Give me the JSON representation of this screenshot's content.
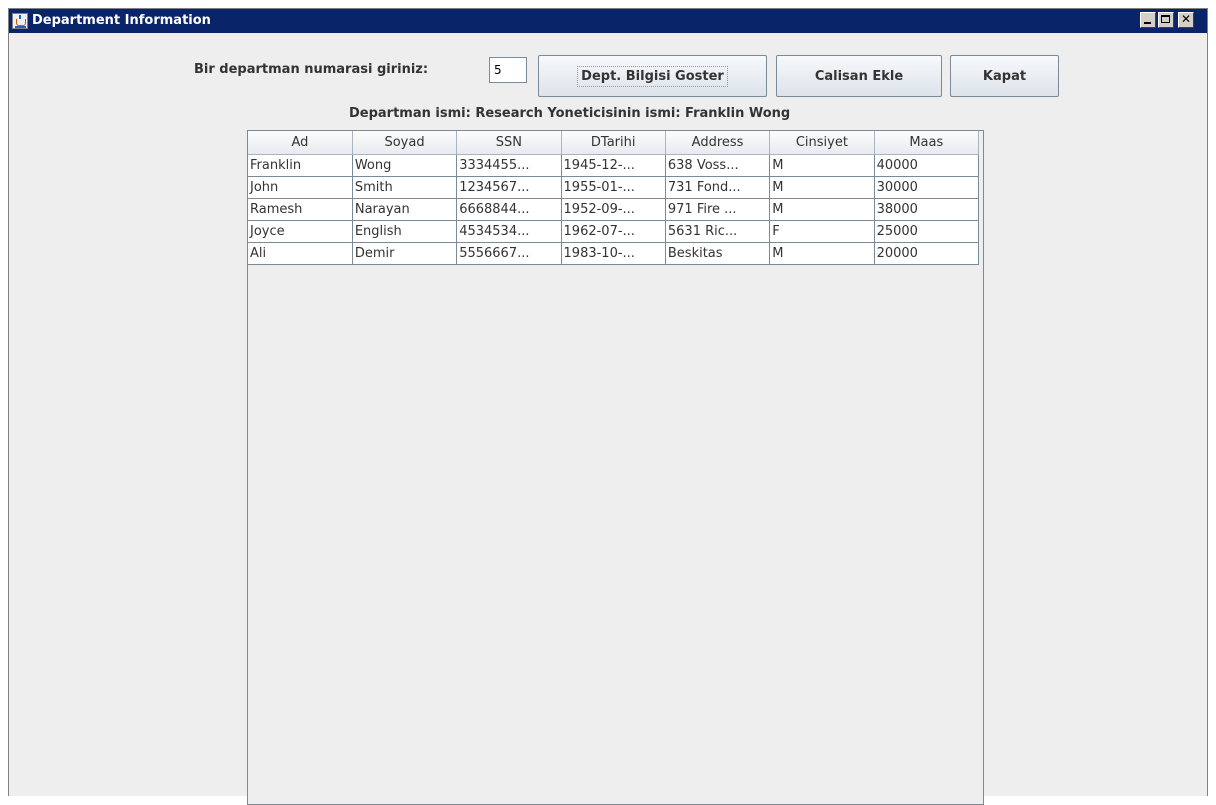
{
  "window": {
    "title": "Department Information"
  },
  "form": {
    "prompt_label": "Bir departman numarasi giriniz:",
    "dept_number_value": "5",
    "show_button_label": "Dept. Bilgisi Goster",
    "add_employee_button_label": "Calisan Ekle",
    "close_button_label": "Kapat"
  },
  "info": {
    "summary": "Departman ismi: Research Yoneticisinin ismi: Franklin Wong"
  },
  "table": {
    "headers": [
      "Ad",
      "Soyad",
      "SSN",
      "DTarihi",
      "Address",
      "Cinsiyet",
      "Maas"
    ],
    "rows": [
      [
        "Franklin",
        "Wong",
        "3334455...",
        "1945-12-...",
        "638 Voss...",
        "M",
        "40000"
      ],
      [
        "John",
        "Smith",
        "1234567...",
        "1955-01-...",
        "731 Fond...",
        "M",
        "30000"
      ],
      [
        "Ramesh",
        "Narayan",
        "6668844...",
        "1952-09-...",
        "971 Fire ...",
        "M",
        "38000"
      ],
      [
        "Joyce",
        "English",
        "4534534...",
        "1962-07-...",
        "5631 Ric...",
        "F",
        "25000"
      ],
      [
        "Ali",
        "Demir",
        "5556667...",
        "1983-10-...",
        "Beskitas",
        "M",
        "20000"
      ]
    ]
  },
  "icons": {
    "app": "java-cup-icon",
    "minimize": "minimize-icon",
    "maximize": "maximize-icon",
    "close": "close-icon"
  },
  "colors": {
    "titlebar": "#0a246a",
    "window_bg": "#eeeeee",
    "button_border": "#7a8a99"
  }
}
